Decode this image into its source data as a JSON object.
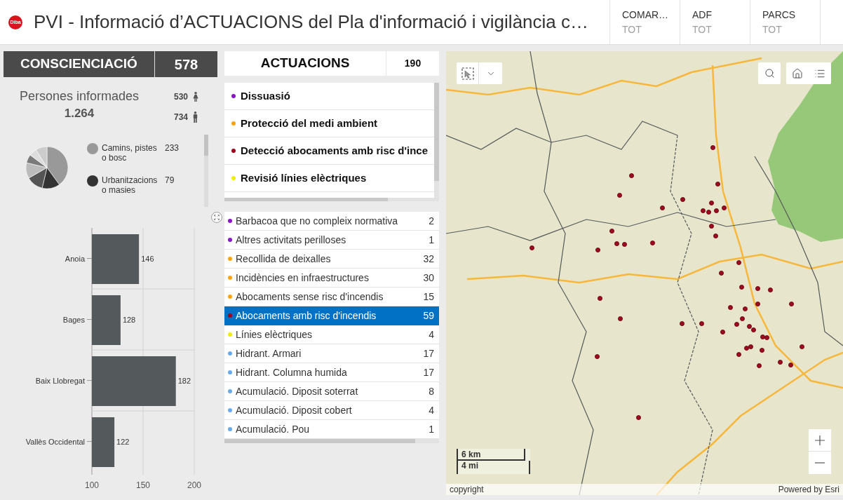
{
  "header": {
    "logo": "Diba",
    "title": "PVI - Informació d’ACTUACIONS del Pla d'informació i vigilància c…",
    "filters": [
      {
        "label": "COMAR…",
        "value": "TOT"
      },
      {
        "label": "ADF",
        "value": "TOT"
      },
      {
        "label": "PARCS",
        "value": "TOT"
      }
    ]
  },
  "awareness": {
    "title": "CONSCIENCIACIÓ",
    "count": "578",
    "people_label": "Persones informades",
    "people_total": "1.264",
    "genders": [
      {
        "kind": "female",
        "count": "530"
      },
      {
        "kind": "male",
        "count": "734"
      }
    ],
    "legend": [
      {
        "label": "Camins, pistes o bosc",
        "value": "233",
        "color": "#999999"
      },
      {
        "label": "Urbanitzacions o masies",
        "value": "79",
        "color": "#333333"
      }
    ],
    "chart_data": {
      "type": "bar",
      "orientation": "horizontal",
      "categories": [
        "Anoia",
        "Bages",
        "Baix Llobregat",
        "Vallès Occidental"
      ],
      "values": [
        146,
        128,
        182,
        122
      ],
      "xlim": [
        100,
        200
      ],
      "xticks": [
        100,
        150,
        200
      ],
      "data_labels": true
    }
  },
  "actions": {
    "title": "ACTUACIONS",
    "count": "190",
    "categories": [
      {
        "label": "Dissuasió",
        "color": "#8a16c8"
      },
      {
        "label": "Protecció del medi ambient",
        "color": "#ffa40a"
      },
      {
        "label": "Detecció abocaments amb risc d'ince",
        "color": "#a0001c"
      },
      {
        "label": "Revisió línies elèctriques",
        "color": "#eeee00"
      }
    ],
    "items": [
      {
        "label": "Barbacoa que no compleix normativa",
        "count": "2",
        "color": "#8a16c8",
        "selected": false
      },
      {
        "label": "Altres activitats perilloses",
        "count": "1",
        "color": "#8a16c8",
        "selected": false
      },
      {
        "label": "Recollida de deixalles",
        "count": "32",
        "color": "#ffa40a",
        "selected": false
      },
      {
        "label": "Incidències en infraestructures",
        "count": "30",
        "color": "#ffa40a",
        "selected": false
      },
      {
        "label": "Abocaments sense risc d'incendis",
        "count": "15",
        "color": "#ffa40a",
        "selected": false
      },
      {
        "label": "Abocaments amb risc d'incendis",
        "count": "59",
        "color": "#a0001c",
        "selected": true
      },
      {
        "label": "Línies elèctriques",
        "count": "4",
        "color": "#eeee00",
        "selected": false
      },
      {
        "label": "Hidrant. Armari",
        "count": "17",
        "color": "#6aaaf0",
        "selected": false
      },
      {
        "label": "Hidrant. Columna humida",
        "count": "17",
        "color": "#6aaaf0",
        "selected": false
      },
      {
        "label": "Acumulació. Diposit soterrat",
        "count": "8",
        "color": "#6aaaf0",
        "selected": false
      },
      {
        "label": "Acumulació. Diposit cobert",
        "count": "4",
        "color": "#6aaaf0",
        "selected": false
      },
      {
        "label": "Acumulació. Pou",
        "count": "1",
        "color": "#6aaaf0",
        "selected": false
      }
    ]
  },
  "map": {
    "scale_bar": {
      "metric": "6 km",
      "imperial": "4 mi"
    },
    "attribution": {
      "left": "copyright",
      "right": "Powered by Esri"
    }
  }
}
